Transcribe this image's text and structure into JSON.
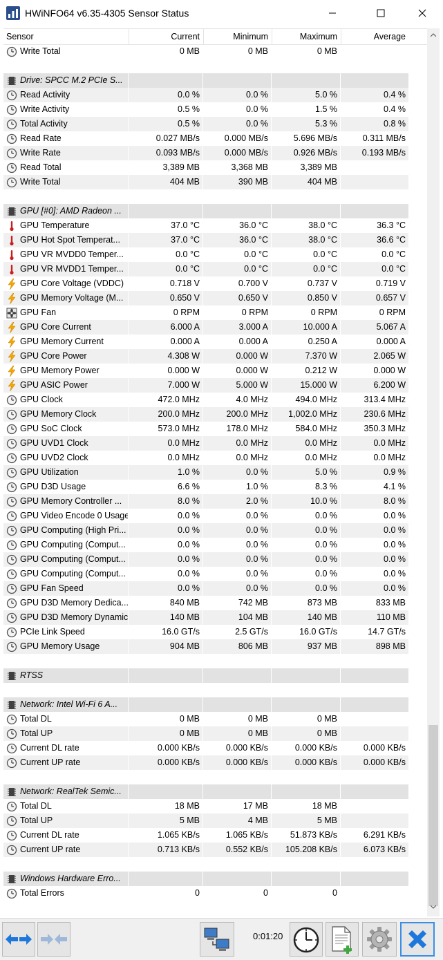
{
  "window": {
    "title": "HWiNFO64 v6.35-4305 Sensor Status"
  },
  "columns": [
    "Sensor",
    "Current",
    "Minimum",
    "Maximum",
    "Average"
  ],
  "rows": [
    {
      "k": "s",
      "i": "clock",
      "n": "Write Total",
      "v": [
        "0 MB",
        "0 MB",
        "0 MB",
        ""
      ]
    },
    {
      "k": "b"
    },
    {
      "k": "g",
      "n": "Drive: SPCC M.2 PCIe S..."
    },
    {
      "k": "s",
      "i": "clock",
      "n": "Read Activity",
      "v": [
        "0.0 %",
        "0.0 %",
        "5.0 %",
        "0.4 %"
      ]
    },
    {
      "k": "s",
      "i": "clock",
      "n": "Write Activity",
      "v": [
        "0.5 %",
        "0.0 %",
        "1.5 %",
        "0.4 %"
      ]
    },
    {
      "k": "s",
      "i": "clock",
      "n": "Total Activity",
      "v": [
        "0.5 %",
        "0.0 %",
        "5.3 %",
        "0.8 %"
      ]
    },
    {
      "k": "s",
      "i": "clock",
      "n": "Read Rate",
      "v": [
        "0.027 MB/s",
        "0.000 MB/s",
        "5.696 MB/s",
        "0.311 MB/s"
      ]
    },
    {
      "k": "s",
      "i": "clock",
      "n": "Write Rate",
      "v": [
        "0.093 MB/s",
        "0.000 MB/s",
        "0.926 MB/s",
        "0.193 MB/s"
      ]
    },
    {
      "k": "s",
      "i": "clock",
      "n": "Read Total",
      "v": [
        "3,389 MB",
        "3,368 MB",
        "3,389 MB",
        ""
      ]
    },
    {
      "k": "s",
      "i": "clock",
      "n": "Write Total",
      "v": [
        "404 MB",
        "390 MB",
        "404 MB",
        ""
      ]
    },
    {
      "k": "b"
    },
    {
      "k": "g",
      "n": "GPU [#0]: AMD Radeon ..."
    },
    {
      "k": "s",
      "i": "therm",
      "n": "GPU Temperature",
      "v": [
        "37.0 °C",
        "36.0 °C",
        "38.0 °C",
        "36.3 °C"
      ]
    },
    {
      "k": "s",
      "i": "therm",
      "n": "GPU Hot Spot Temperat...",
      "v": [
        "37.0 °C",
        "36.0 °C",
        "38.0 °C",
        "36.6 °C"
      ]
    },
    {
      "k": "s",
      "i": "therm",
      "n": "GPU VR MVDD0 Temper...",
      "v": [
        "0.0 °C",
        "0.0 °C",
        "0.0 °C",
        "0.0 °C"
      ]
    },
    {
      "k": "s",
      "i": "therm",
      "n": "GPU VR MVDD1 Temper...",
      "v": [
        "0.0 °C",
        "0.0 °C",
        "0.0 °C",
        "0.0 °C"
      ]
    },
    {
      "k": "s",
      "i": "bolt",
      "n": "GPU Core Voltage (VDDC)",
      "v": [
        "0.718 V",
        "0.700 V",
        "0.737 V",
        "0.719 V"
      ]
    },
    {
      "k": "s",
      "i": "bolt",
      "n": "GPU Memory Voltage (M...",
      "v": [
        "0.650 V",
        "0.650 V",
        "0.850 V",
        "0.657 V"
      ]
    },
    {
      "k": "s",
      "i": "fan",
      "n": "GPU Fan",
      "v": [
        "0 RPM",
        "0 RPM",
        "0 RPM",
        "0 RPM"
      ]
    },
    {
      "k": "s",
      "i": "bolt",
      "n": "GPU Core Current",
      "v": [
        "6.000 A",
        "3.000 A",
        "10.000 A",
        "5.067 A"
      ]
    },
    {
      "k": "s",
      "i": "bolt",
      "n": "GPU Memory Current",
      "v": [
        "0.000 A",
        "0.000 A",
        "0.250 A",
        "0.000 A"
      ]
    },
    {
      "k": "s",
      "i": "bolt",
      "n": "GPU Core Power",
      "v": [
        "4.308 W",
        "0.000 W",
        "7.370 W",
        "2.065 W"
      ]
    },
    {
      "k": "s",
      "i": "bolt",
      "n": "GPU Memory Power",
      "v": [
        "0.000 W",
        "0.000 W",
        "0.212 W",
        "0.000 W"
      ]
    },
    {
      "k": "s",
      "i": "bolt",
      "n": "GPU ASIC Power",
      "v": [
        "7.000 W",
        "5.000 W",
        "15.000 W",
        "6.200 W"
      ]
    },
    {
      "k": "s",
      "i": "clock",
      "n": "GPU Clock",
      "v": [
        "472.0 MHz",
        "4.0 MHz",
        "494.0 MHz",
        "313.4 MHz"
      ]
    },
    {
      "k": "s",
      "i": "clock",
      "n": "GPU Memory Clock",
      "v": [
        "200.0 MHz",
        "200.0 MHz",
        "1,002.0 MHz",
        "230.6 MHz"
      ]
    },
    {
      "k": "s",
      "i": "clock",
      "n": "GPU SoC Clock",
      "v": [
        "573.0 MHz",
        "178.0 MHz",
        "584.0 MHz",
        "350.3 MHz"
      ]
    },
    {
      "k": "s",
      "i": "clock",
      "n": "GPU UVD1 Clock",
      "v": [
        "0.0 MHz",
        "0.0 MHz",
        "0.0 MHz",
        "0.0 MHz"
      ]
    },
    {
      "k": "s",
      "i": "clock",
      "n": "GPU UVD2 Clock",
      "v": [
        "0.0 MHz",
        "0.0 MHz",
        "0.0 MHz",
        "0.0 MHz"
      ]
    },
    {
      "k": "s",
      "i": "clock",
      "n": "GPU Utilization",
      "v": [
        "1.0 %",
        "0.0 %",
        "5.0 %",
        "0.9 %"
      ]
    },
    {
      "k": "s",
      "i": "clock",
      "n": "GPU D3D Usage",
      "v": [
        "6.6 %",
        "1.0 %",
        "8.3 %",
        "4.1 %"
      ]
    },
    {
      "k": "s",
      "i": "clock",
      "n": "GPU Memory Controller ...",
      "v": [
        "8.0 %",
        "2.0 %",
        "10.0 %",
        "8.0 %"
      ]
    },
    {
      "k": "s",
      "i": "clock",
      "n": "GPU Video Encode 0 Usage",
      "v": [
        "0.0 %",
        "0.0 %",
        "0.0 %",
        "0.0 %"
      ]
    },
    {
      "k": "s",
      "i": "clock",
      "n": "GPU Computing (High Pri...",
      "v": [
        "0.0 %",
        "0.0 %",
        "0.0 %",
        "0.0 %"
      ]
    },
    {
      "k": "s",
      "i": "clock",
      "n": "GPU Computing (Comput...",
      "v": [
        "0.0 %",
        "0.0 %",
        "0.0 %",
        "0.0 %"
      ]
    },
    {
      "k": "s",
      "i": "clock",
      "n": "GPU Computing (Comput...",
      "v": [
        "0.0 %",
        "0.0 %",
        "0.0 %",
        "0.0 %"
      ]
    },
    {
      "k": "s",
      "i": "clock",
      "n": "GPU Computing (Comput...",
      "v": [
        "0.0 %",
        "0.0 %",
        "0.0 %",
        "0.0 %"
      ]
    },
    {
      "k": "s",
      "i": "clock",
      "n": "GPU Fan Speed",
      "v": [
        "0.0 %",
        "0.0 %",
        "0.0 %",
        "0.0 %"
      ]
    },
    {
      "k": "s",
      "i": "clock",
      "n": "GPU D3D Memory Dedica...",
      "v": [
        "840 MB",
        "742 MB",
        "873 MB",
        "833 MB"
      ]
    },
    {
      "k": "s",
      "i": "clock",
      "n": "GPU D3D Memory Dynamic",
      "v": [
        "140 MB",
        "104 MB",
        "140 MB",
        "110 MB"
      ]
    },
    {
      "k": "s",
      "i": "clock",
      "n": "PCIe Link Speed",
      "v": [
        "16.0 GT/s",
        "2.5 GT/s",
        "16.0 GT/s",
        "14.7 GT/s"
      ]
    },
    {
      "k": "s",
      "i": "clock",
      "n": "GPU Memory Usage",
      "v": [
        "904 MB",
        "806 MB",
        "937 MB",
        "898 MB"
      ]
    },
    {
      "k": "b"
    },
    {
      "k": "g",
      "n": "RTSS"
    },
    {
      "k": "b"
    },
    {
      "k": "g",
      "n": "Network: Intel Wi-Fi 6 A..."
    },
    {
      "k": "s",
      "i": "clock",
      "n": "Total DL",
      "v": [
        "0 MB",
        "0 MB",
        "0 MB",
        ""
      ]
    },
    {
      "k": "s",
      "i": "clock",
      "n": "Total UP",
      "v": [
        "0 MB",
        "0 MB",
        "0 MB",
        ""
      ]
    },
    {
      "k": "s",
      "i": "clock",
      "n": "Current DL rate",
      "v": [
        "0.000 KB/s",
        "0.000 KB/s",
        "0.000 KB/s",
        "0.000 KB/s"
      ]
    },
    {
      "k": "s",
      "i": "clock",
      "n": "Current UP rate",
      "v": [
        "0.000 KB/s",
        "0.000 KB/s",
        "0.000 KB/s",
        "0.000 KB/s"
      ]
    },
    {
      "k": "b"
    },
    {
      "k": "g",
      "n": "Network: RealTek Semic..."
    },
    {
      "k": "s",
      "i": "clock",
      "n": "Total DL",
      "v": [
        "18 MB",
        "17 MB",
        "18 MB",
        ""
      ]
    },
    {
      "k": "s",
      "i": "clock",
      "n": "Total UP",
      "v": [
        "5 MB",
        "4 MB",
        "5 MB",
        ""
      ]
    },
    {
      "k": "s",
      "i": "clock",
      "n": "Current DL rate",
      "v": [
        "1.065 KB/s",
        "1.065 KB/s",
        "51.873 KB/s",
        "6.291 KB/s"
      ]
    },
    {
      "k": "s",
      "i": "clock",
      "n": "Current UP rate",
      "v": [
        "0.713 KB/s",
        "0.552 KB/s",
        "105.208 KB/s",
        "6.073 KB/s"
      ]
    },
    {
      "k": "b"
    },
    {
      "k": "g",
      "n": "Windows Hardware Erro..."
    },
    {
      "k": "s",
      "i": "clock",
      "n": "Total Errors",
      "v": [
        "0",
        "0",
        "0",
        ""
      ]
    },
    {
      "k": "b"
    }
  ],
  "footer": {
    "timer": "0:01:20"
  },
  "icons": {
    "clock": "clock-icon",
    "therm": "thermometer-icon",
    "bolt": "lightning-icon",
    "fan": "fan-icon",
    "chip": "chip-icon"
  },
  "colors": {
    "group_bg": "#e2e2e2",
    "shade_bg": "#f0f0f0",
    "bolt": "#f5a800",
    "therm": "#c81e1e",
    "blue_arrow": "#1e78dc"
  }
}
